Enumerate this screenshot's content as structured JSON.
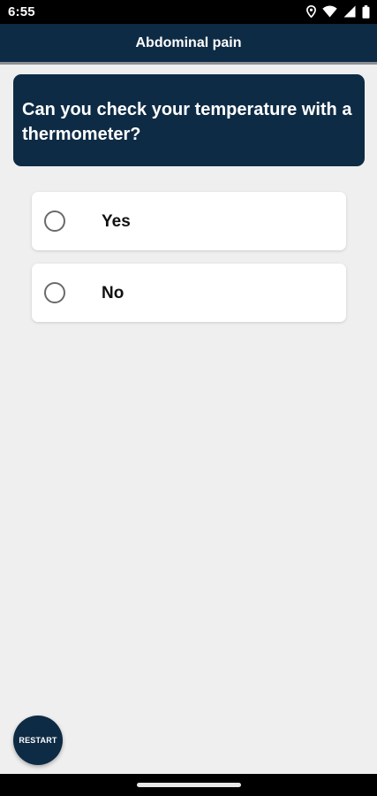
{
  "status_bar": {
    "time": "6:55",
    "icons": [
      "location-icon",
      "wifi-icon",
      "cell-signal-icon",
      "battery-icon"
    ]
  },
  "app_bar": {
    "title": "Abdominal pain"
  },
  "question": {
    "text": "Can you check your temperature with a thermometer?"
  },
  "options": [
    {
      "label": "Yes",
      "selected": false
    },
    {
      "label": "No",
      "selected": false
    }
  ],
  "restart": {
    "label": "RESTART"
  },
  "colors": {
    "primary": "#0e2b45",
    "background": "#efefef",
    "card": "#ffffff"
  }
}
